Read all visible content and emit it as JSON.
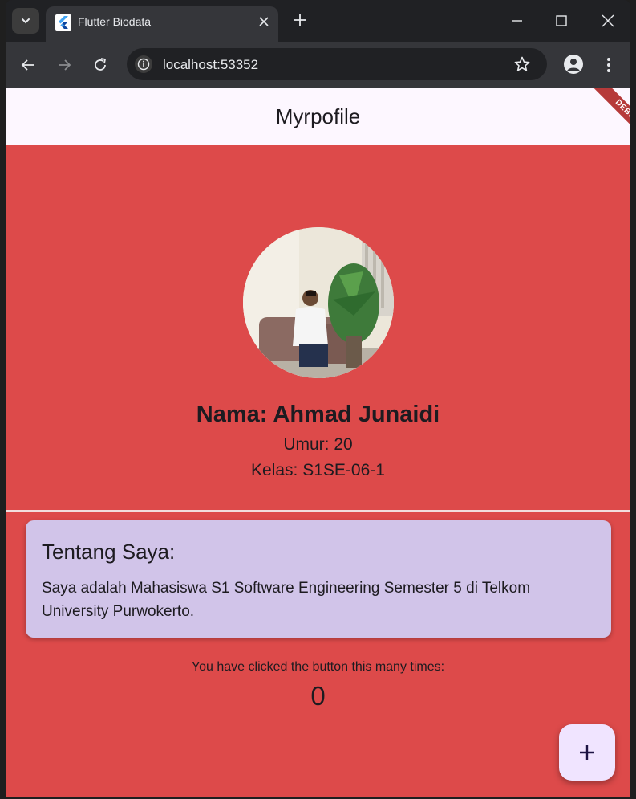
{
  "browser": {
    "tab": {
      "title": "Flutter Biodata"
    },
    "address": {
      "url": "localhost:53352"
    }
  },
  "app": {
    "appbar_title": "Myrpofile",
    "debug_label": "DEBUG",
    "profile": {
      "name": "Nama: Ahmad Junaidi",
      "age": "Umur: 20",
      "kelas": "Kelas: S1SE-06-1"
    },
    "about_card": {
      "heading": "Tentang Saya:",
      "body": "Saya adalah Mahasiswa S1 Software Engineering Semester 5 di Telkom University Purwokerto."
    },
    "counter": {
      "label": "You have clicked the button this many times:",
      "value": "0"
    }
  },
  "colors": {
    "background": "#dd4a4a",
    "appbar": "#fdf7ff",
    "card": "#d1c4e9",
    "fab": "#f0e4ff",
    "browser_frame": "#35363a"
  },
  "icons": [
    "chevron-down-icon",
    "flutter-icon",
    "close-icon",
    "plus-icon",
    "minimize-icon",
    "maximize-icon",
    "back-arrow-icon",
    "forward-arrow-icon",
    "reload-icon",
    "info-icon",
    "star-icon",
    "profile-icon",
    "kebab-icon",
    "add-icon"
  ]
}
